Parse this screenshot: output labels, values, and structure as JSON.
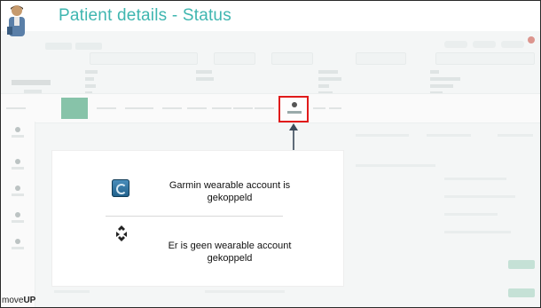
{
  "page": {
    "title": "Patient details - Status"
  },
  "legend": {
    "connected_text": "Garmin wearable account is gekoppeld",
    "not_connected_text": "Er is geen wearable account gekoppeld",
    "connected_icon": "garmin-connect-icon",
    "not_connected_icon": "link-broken-icon"
  },
  "annotation": {
    "highlight_color": "#e01b1b",
    "arrow_icon": "arrow-up-icon"
  },
  "brand": {
    "prefix": "move",
    "suffix": "UP"
  },
  "colors": {
    "title": "#3fb6b0",
    "active_tab": "#2f9a6b"
  }
}
